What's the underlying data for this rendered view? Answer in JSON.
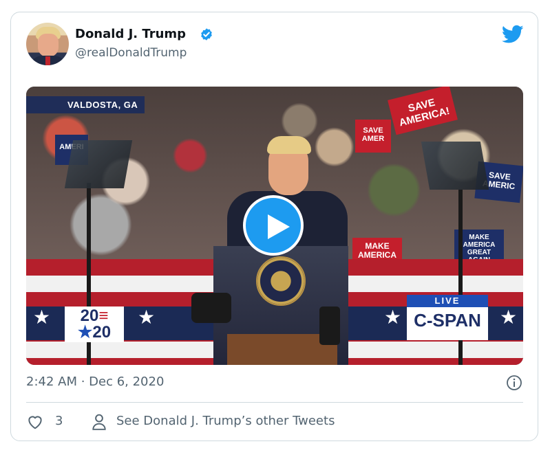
{
  "tweet": {
    "author_name": "Donald J. Trump",
    "handle": "@realDonaldTrump",
    "timestamp": "2:42 AM · Dec 6, 2020",
    "like_count": "3",
    "see_other_label": "See Donald J. Trump’s other Tweets"
  },
  "video": {
    "location_label": "VALDOSTA, GA",
    "live_label": "LIVE",
    "network_label": "C-SPAN",
    "logo_top": "20",
    "logo_bottom": "20",
    "signs": {
      "save_america": "SAVE AMERICA!",
      "make_america": "MAKE AMERICA",
      "save_left": "SAVE AMER",
      "amer_left": "AMERI",
      "save_right": "SAVE AMERIC",
      "maga_right": "MAKE AMERICA GREAT AGAIN"
    }
  },
  "colors": {
    "twitter_blue": "#1d9bf0",
    "secondary_text": "#536471",
    "border": "#cfd9de"
  },
  "icons": {
    "verified": "verified-badge-icon",
    "bird": "twitter-bird-icon",
    "play": "play-icon",
    "info": "info-icon",
    "heart": "heart-icon",
    "person": "person-icon"
  }
}
